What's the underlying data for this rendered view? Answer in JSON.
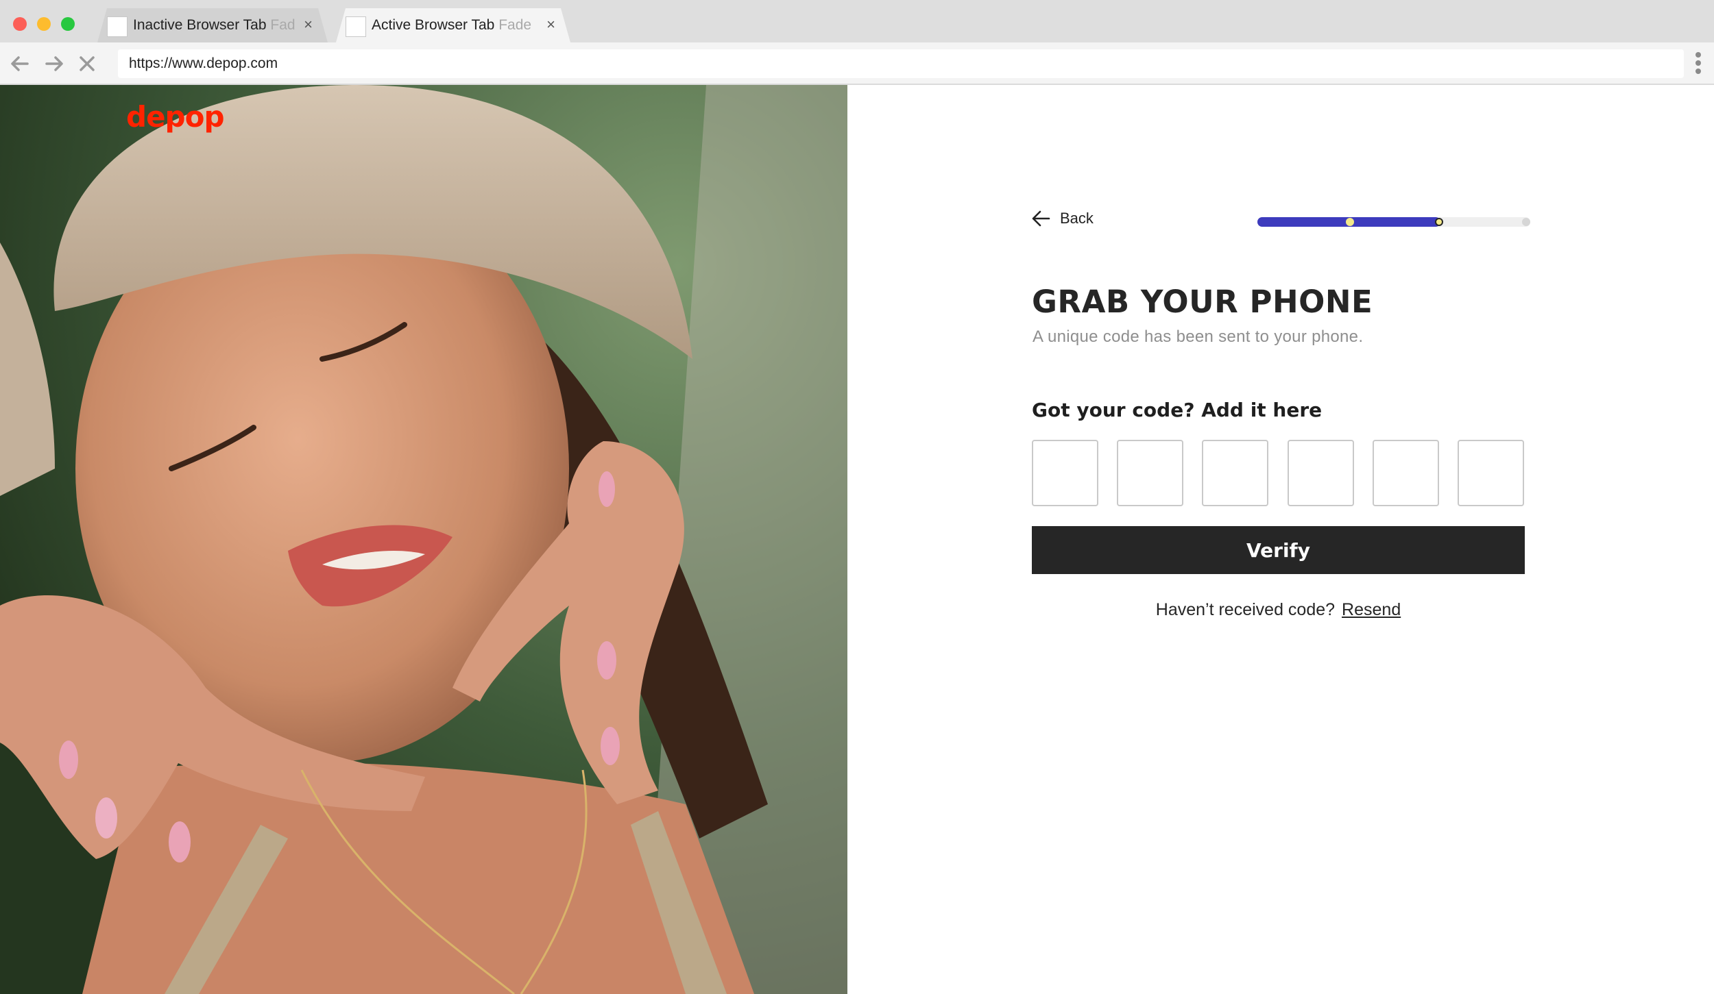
{
  "browser": {
    "tabs": [
      {
        "title": "Inactive Browser Tab",
        "fade": "Fad",
        "close": "×",
        "active": false
      },
      {
        "title": "Active Browser Tab",
        "fade": "Fade",
        "close": "×",
        "active": true
      }
    ],
    "url": "https://www.depop.com"
  },
  "brand": {
    "logo_text": "depop",
    "color": "#ff2300"
  },
  "hero": {
    "dominant_colors": [
      "#2f4a2c",
      "#c7b39a",
      "#d39a7c",
      "#e89bb0"
    ]
  },
  "form": {
    "back_label": "Back",
    "progress": {
      "fraction": 0.67,
      "fill_color": "#3d3bbd",
      "track_color": "#efefef",
      "steps_total": 3,
      "steps_done": 2
    },
    "headline": "GRAB YOUR PHONE",
    "subtitle": "A unique code has been sent to your phone.",
    "code_label": "Got your code? Add it here",
    "code_length": 6,
    "verify_label": "Verify",
    "resend_prompt": "Haven’t received code?",
    "resend_link": "Resend"
  }
}
